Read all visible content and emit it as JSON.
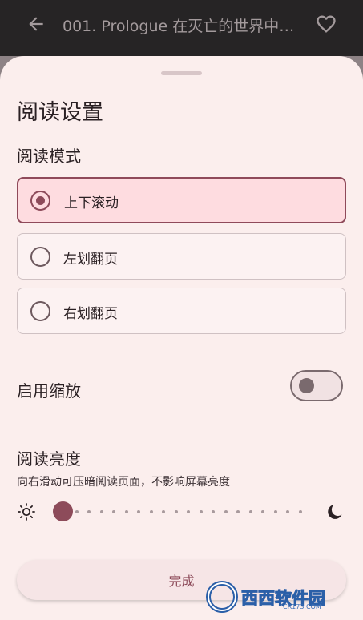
{
  "appbar": {
    "title": "001. Prologue 在灭亡的世界中…"
  },
  "sheet": {
    "title": "阅读设置",
    "reading_mode": {
      "label": "阅读模式",
      "options": [
        {
          "label": "上下滚动",
          "selected": true
        },
        {
          "label": "左划翻页",
          "selected": false
        },
        {
          "label": "右划翻页",
          "selected": false
        }
      ]
    },
    "zoom": {
      "label": "启用缩放",
      "enabled": false
    },
    "brightness": {
      "label": "阅读亮度",
      "hint": "向右滑动可压暗阅读页面，不影响屏幕亮度",
      "value": 0
    },
    "done_label": "完成"
  },
  "watermark": {
    "text": "西西软件园",
    "url": "CR173.COM"
  },
  "colors": {
    "accent": "#8d4b5a",
    "sheet_bg": "#fbeeed",
    "selected_bg": "#fedce0",
    "appbar_bg": "#262425"
  }
}
